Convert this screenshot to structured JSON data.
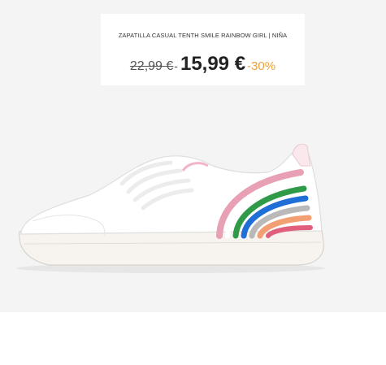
{
  "product": {
    "title": "ZAPATILLA CASUAL TENTH SMILE RAINBOW GIRL | NIÑA",
    "old_price": "22,99 €",
    "separator": "-",
    "new_price": "15,99 €",
    "discount": "-30%"
  },
  "colors": {
    "stage_background": "#f4f4f4",
    "discount": "#f0a23a",
    "rainbow": [
      "#e8a0b4",
      "#ffffff",
      "#2f9a48",
      "#1f6fd6",
      "#b9b9b9",
      "#f2a073",
      "#e05f7c"
    ]
  },
  "image": {
    "subject": "white kids sneaker with glitter rainbow"
  }
}
